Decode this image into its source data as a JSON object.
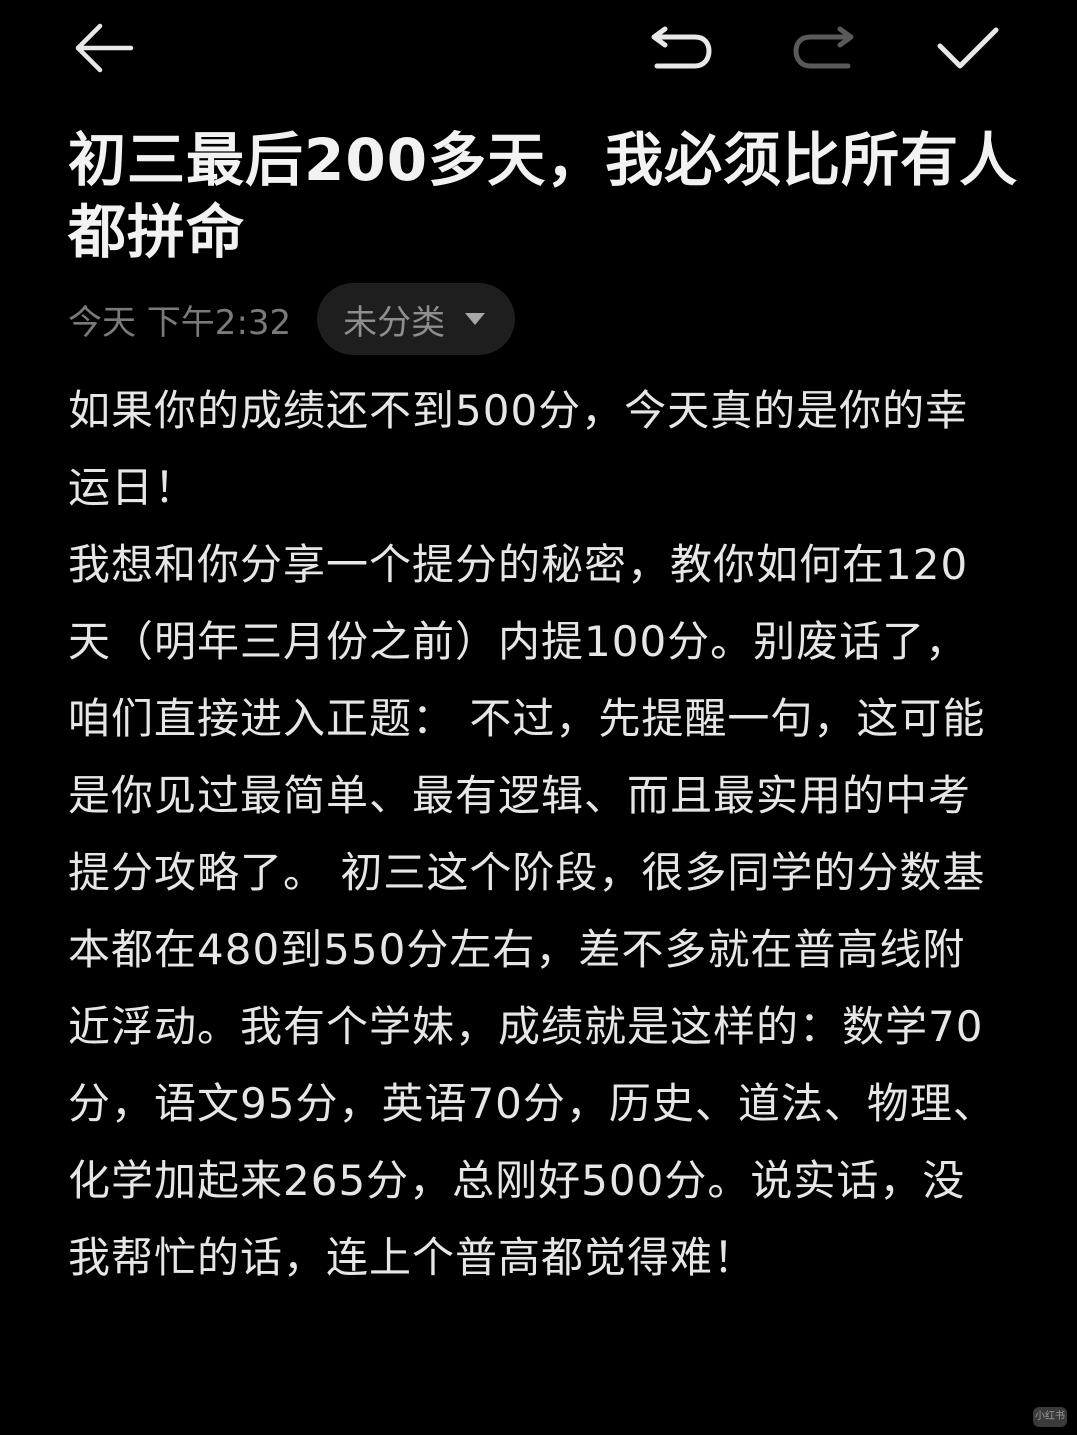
{
  "toolbar": {
    "back_icon": "arrow-left-icon",
    "undo_icon": "undo-icon",
    "redo_icon": "redo-icon",
    "done_icon": "checkmark-icon",
    "redo_enabled": false
  },
  "note": {
    "title": "初三最后200多天，我必须比所有人都拼命",
    "timestamp": "今天 下午2:32",
    "category": "未分类",
    "body": "如果你的成绩还不到500分，今天真的是你的幸运日！\n我想和你分享一个提分的秘密，教你如何在120天（明年三月份之前）内提100分。别废话了，咱们直接进入正题： 不过，先提醒一句，这可能是你见过最简单、最有逻辑、而且最实用的中考提分攻略了。 初三这个阶段，很多同学的分数基本都在480到550分左右，差不多就在普高线附近浮动。我有个学妹，成绩就是这样的：数学70分，语文95分，英语70分，历史、道法、物理、化学加起来265分，总刚好500分。说实话，没我帮忙的话，连上个普高都觉得难！"
  },
  "watermark": "小红书",
  "colors": {
    "background": "#000000",
    "title": "#f2f2f2",
    "body": "#e6e6e6",
    "meta": "#7a7a7a",
    "chip_bg": "#1e1e1e",
    "icon_active": "#e8e8e8",
    "icon_disabled": "#5a5a5a"
  }
}
